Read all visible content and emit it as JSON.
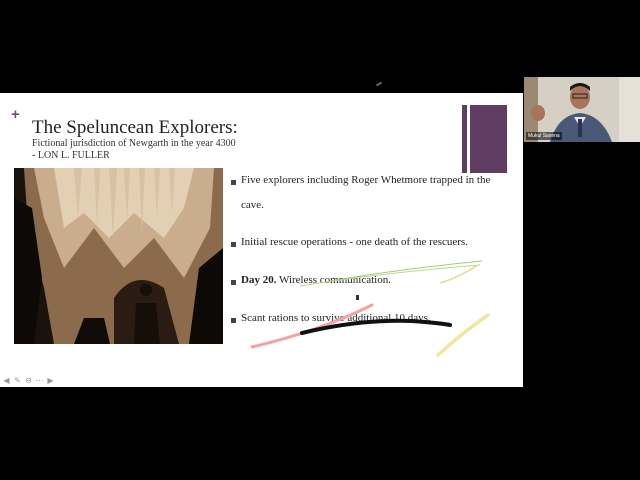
{
  "slide": {
    "title": "The Speluncean Explorers:",
    "subtitle_line1": "Fictional jurisdiction of Newgarth in the year 4300",
    "subtitle_line2": "- LON L. FULLER",
    "bullets": [
      {
        "bold": "",
        "text": "Five explorers including Roger Whetmore trapped in the cave."
      },
      {
        "bold": "",
        "text": "Initial rescue operations -  one death of  the rescuers."
      },
      {
        "bold": "Day 20.",
        "text": " Wireless communication."
      },
      {
        "bold": "",
        "text": "Scant rations to survive additional 10 days."
      }
    ],
    "accent_color": "#5f3d63"
  },
  "video": {
    "participant_name": "Mukul Saxena"
  },
  "toolbar": {
    "icons": [
      "arrow-left-icon",
      "pen-icon",
      "zoom-out-icon",
      "more-icon",
      "arrow-right-icon"
    ]
  }
}
